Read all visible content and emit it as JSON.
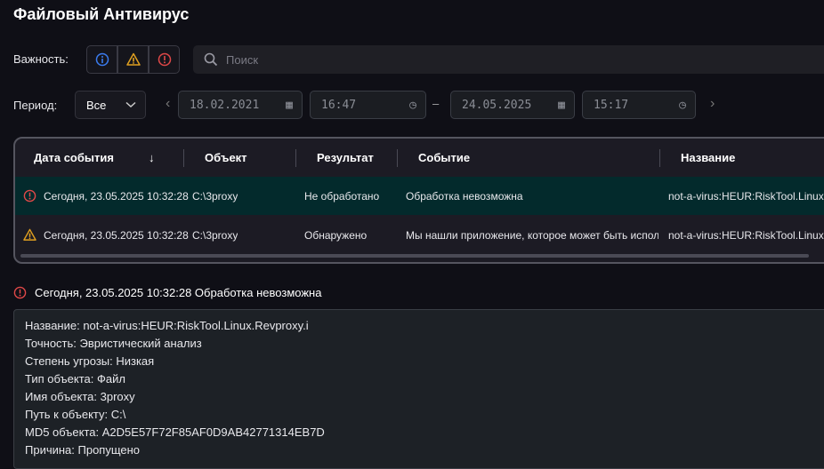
{
  "title": "Файловый Антивирус",
  "filters": {
    "severity_label": "Важность:",
    "severity_buttons": [
      "info-icon",
      "warning-icon",
      "error-icon"
    ],
    "search_placeholder": "Поиск",
    "period_label": "Период:",
    "period_value": "Все",
    "date_from": "18.02.2021",
    "time_from": "16:47",
    "dash": "–",
    "date_to": "24.05.2025",
    "time_to": "15:17"
  },
  "colors": {
    "info": "#3b7cf0",
    "warning": "#e0a020",
    "error": "#e04848",
    "selected_row": "#032a2c"
  },
  "table": {
    "columns": [
      "Дата события",
      "Объект",
      "Результат",
      "Событие",
      "Название"
    ],
    "sort_icon": "↓",
    "rows": [
      {
        "severity": "error",
        "date": "Сегодня, 23.05.2025 10:32:28",
        "object": "C:\\3proxy",
        "result": "Не обработано",
        "event": "Обработка невозможна",
        "name": "not-a-virus:HEUR:RiskTool.Linux.Revproxy.i"
      },
      {
        "severity": "warning",
        "date": "Сегодня, 23.05.2025 10:32:28",
        "object": "C:\\3proxy",
        "result": "Обнаружено",
        "event": "Мы нашли приложение, которое может быть использовано злоумышленниками",
        "name": "not-a-virus:HEUR:RiskTool.Linux.Revproxy.i"
      }
    ]
  },
  "detail": {
    "heading": "Сегодня, 23.05.2025 10:32:28 Обработка невозможна",
    "lines": [
      "Название: not-a-virus:HEUR:RiskTool.Linux.Revproxy.i",
      "Точность: Эвристический анализ",
      "Степень угрозы: Низкая",
      "Тип объекта: Файл",
      "Имя объекта: 3proxy",
      "Путь к объекту: C:\\",
      "MD5 объекта: A2D5E57F72F85AF0D9AB42771314EB7D",
      "Причина: Пропущено"
    ]
  }
}
